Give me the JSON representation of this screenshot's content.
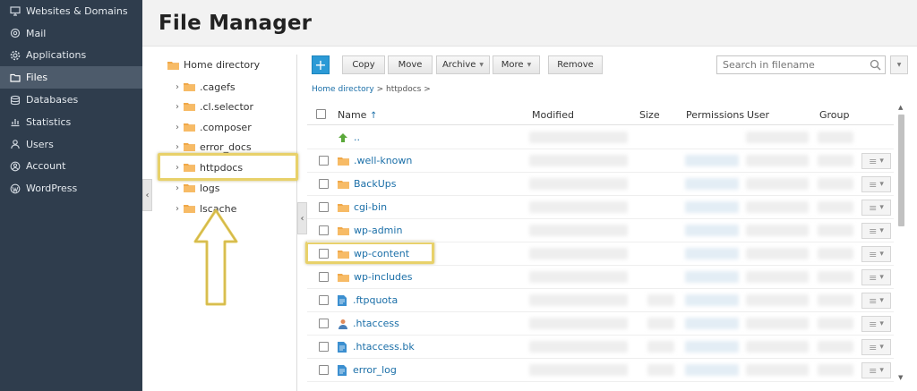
{
  "sidebar": {
    "items": [
      {
        "label": "Websites & Domains",
        "icon": "monitor-icon"
      },
      {
        "label": "Mail",
        "icon": "mail-icon"
      },
      {
        "label": "Applications",
        "icon": "gear-icon"
      },
      {
        "label": "Files",
        "icon": "folder-icon",
        "active": true
      },
      {
        "label": "Databases",
        "icon": "database-icon"
      },
      {
        "label": "Statistics",
        "icon": "chart-icon"
      },
      {
        "label": "Users",
        "icon": "user-icon"
      },
      {
        "label": "Account",
        "icon": "account-icon"
      },
      {
        "label": "WordPress",
        "icon": "wordpress-icon"
      }
    ]
  },
  "header": {
    "title": "File Manager"
  },
  "tree": {
    "root": "Home directory",
    "items": [
      ".cagefs",
      ".cl.selector",
      ".composer",
      "error_docs",
      "httpdocs",
      "logs",
      "lscache"
    ],
    "highlighted": "httpdocs"
  },
  "toolbar": {
    "add_label": "+",
    "copy": "Copy",
    "move": "Move",
    "archive": "Archive",
    "more": "More",
    "remove": "Remove"
  },
  "search": {
    "placeholder": "Search in filename"
  },
  "breadcrumb": {
    "root": "Home directory",
    "separator": ">",
    "current": "httpdocs"
  },
  "table": {
    "columns": {
      "name": "Name",
      "sort_indicator": "↑",
      "modified": "Modified",
      "size": "Size",
      "permissions": "Permissions",
      "user": "User",
      "group": "Group"
    },
    "rows": [
      {
        "name": "..",
        "type": "up"
      },
      {
        "name": ".well-known",
        "type": "folder"
      },
      {
        "name": "BackUps",
        "type": "folder"
      },
      {
        "name": "cgi-bin",
        "type": "folder"
      },
      {
        "name": "wp-admin",
        "type": "folder"
      },
      {
        "name": "wp-content",
        "type": "folder",
        "highlighted": true
      },
      {
        "name": "wp-includes",
        "type": "folder"
      },
      {
        "name": ".ftpquota",
        "type": "file"
      },
      {
        "name": ".htaccess",
        "type": "user-file"
      },
      {
        "name": ".htaccess.bk",
        "type": "file"
      },
      {
        "name": "error_log",
        "type": "file"
      }
    ]
  },
  "colors": {
    "sidebar_bg": "#2f3d4d",
    "sidebar_active": "#4d5b6b",
    "accent": "#2b9ad6",
    "link": "#1b6fa8",
    "folder": "#f0a848",
    "highlight": "#e8d16a"
  }
}
